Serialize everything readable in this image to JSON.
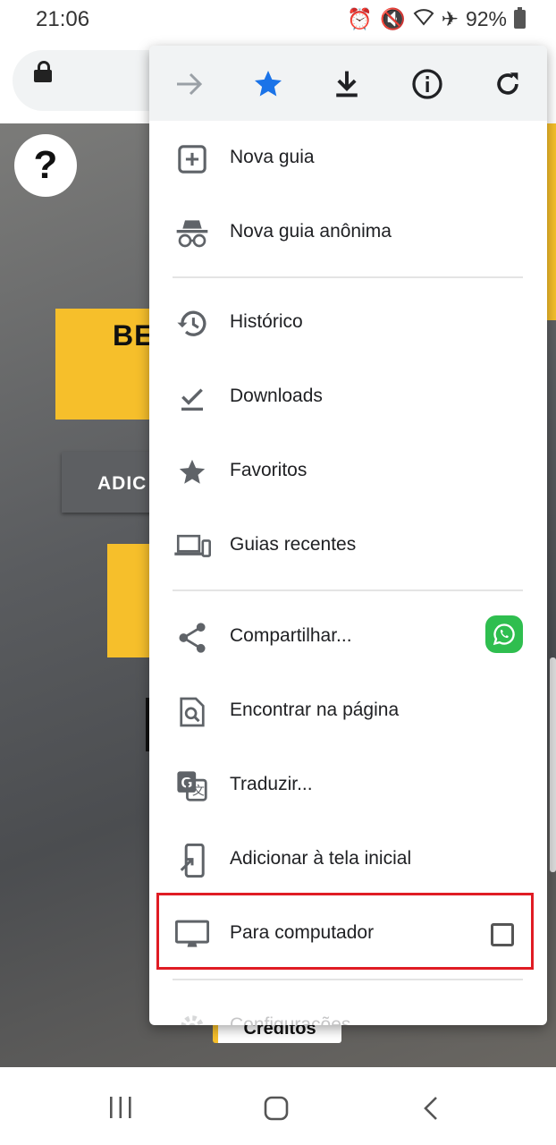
{
  "status_bar": {
    "time": "21:06",
    "battery": "92%",
    "icons": [
      "alarm-icon",
      "mute-icon",
      "wifi-icon",
      "airplane-icon",
      "battery-icon"
    ]
  },
  "browser": {
    "url_hidden": true
  },
  "page": {
    "help_label": "?",
    "card_title": "BE",
    "button_label": "ADIC",
    "credits_label": "Créditos"
  },
  "menu": {
    "toolbar": [
      "forward-icon",
      "bookmark-star-icon",
      "download-icon",
      "info-icon",
      "refresh-icon"
    ],
    "items": [
      {
        "label": "Nova guia",
        "icon": "new-tab-icon"
      },
      {
        "label": "Nova guia anônima",
        "icon": "incognito-icon"
      },
      {
        "label": "Histórico",
        "icon": "history-icon"
      },
      {
        "label": "Downloads",
        "icon": "downloads-icon"
      },
      {
        "label": "Favoritos",
        "icon": "star-icon"
      },
      {
        "label": "Guias recentes",
        "icon": "recent-tabs-icon"
      },
      {
        "label": "Compartilhar...",
        "icon": "share-icon"
      },
      {
        "label": "Encontrar na página",
        "icon": "find-in-page-icon"
      },
      {
        "label": "Traduzir...",
        "icon": "translate-icon"
      },
      {
        "label": "Adicionar à tela inicial",
        "icon": "add-to-home-icon"
      },
      {
        "label": "Para computador",
        "icon": "desktop-icon",
        "checked": false
      },
      {
        "label": "Configurações",
        "icon": "settings-icon"
      }
    ]
  },
  "colors": {
    "accent_blue": "#1a73e8",
    "highlight_red": "#e01c24",
    "site_yellow": "#f6bf2b",
    "whatsapp_green": "#2fbe4f"
  },
  "nav_bar": [
    "recents-icon",
    "home-icon",
    "back-icon"
  ]
}
